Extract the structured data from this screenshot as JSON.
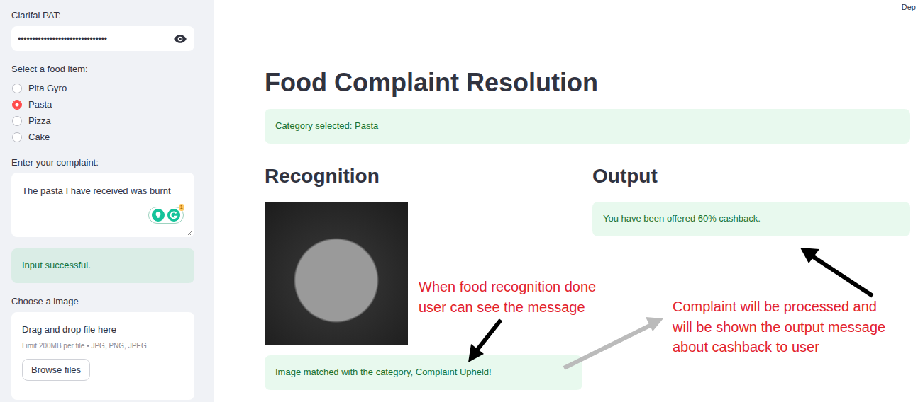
{
  "header": {
    "deploy": "Dep"
  },
  "sidebar": {
    "pat": {
      "label": "Clarifai PAT:",
      "value": "•••••••••••••••••••••••••••••••"
    },
    "food": {
      "label": "Select a food item:",
      "options": [
        {
          "label": "Pita Gyro",
          "selected": false
        },
        {
          "label": "Pasta",
          "selected": true
        },
        {
          "label": "Pizza",
          "selected": false
        },
        {
          "label": "Cake",
          "selected": false
        }
      ]
    },
    "complaint": {
      "label": "Enter your complaint:",
      "value": "The pasta I have received was burnt",
      "badge": "1"
    },
    "input_status": "Input successful.",
    "upload": {
      "label": "Choose a image",
      "prompt": "Drag and drop file here",
      "limit": "Limit 200MB per file • JPG, PNG, JPEG",
      "button": "Browse files"
    }
  },
  "main": {
    "title": "Food Complaint Resolution",
    "category_status": "Category selected: Pasta",
    "recognition": {
      "heading": "Recognition",
      "status": "Image matched with the category, Complaint Upheld!"
    },
    "output": {
      "heading": "Output",
      "message": "You have been offered 60% cashback."
    }
  },
  "annotations": [
    {
      "lines": [
        "When food recognition done",
        "user can see the message"
      ]
    },
    {
      "lines": [
        "Complaint will be processed and",
        "will be shown the output message",
        "about cashback to user"
      ]
    }
  ]
}
